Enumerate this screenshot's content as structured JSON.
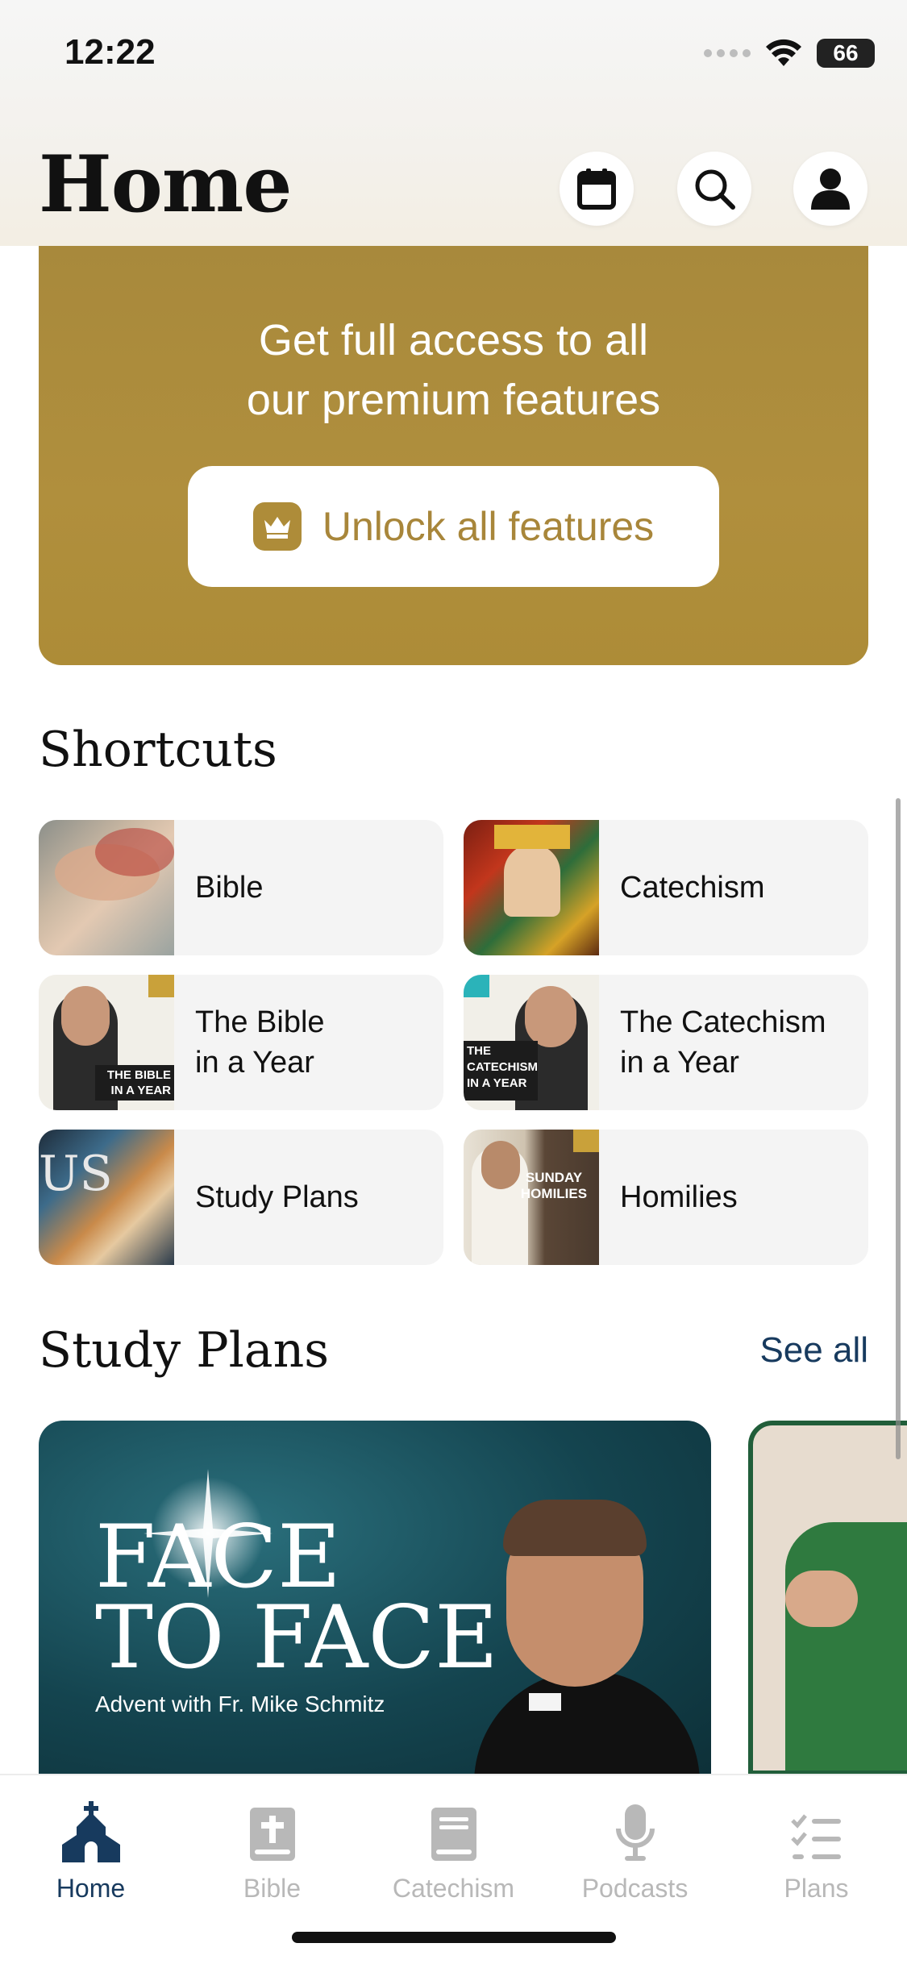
{
  "status_bar": {
    "time": "12:22",
    "battery": "66"
  },
  "header": {
    "title": "Home"
  },
  "promo": {
    "line1": "Get full access to all",
    "line2": "our premium features",
    "button_label": "Unlock all features"
  },
  "shortcuts": {
    "title": "Shortcuts",
    "items": [
      {
        "label": "Bible"
      },
      {
        "label": "Catechism"
      },
      {
        "label": "The Bible\nin a Year",
        "thumb_text": "THE BIBLE IN A YEAR"
      },
      {
        "label": "The Catechism\nin a Year",
        "thumb_text": "THE CATECHISM IN A YEAR"
      },
      {
        "label": "Study Plans"
      },
      {
        "label": "Homilies",
        "thumb_text": "SUNDAY HOMILIES"
      }
    ]
  },
  "study_plans": {
    "title": "Study Plans",
    "see_all": "See all",
    "featured": {
      "title_line1": "FACE",
      "title_line2": "TO FACE",
      "subtitle": "Advent with Fr. Mike Schmitz"
    }
  },
  "tabbar": {
    "items": [
      {
        "label": "Home",
        "icon": "church-icon",
        "active": true
      },
      {
        "label": "Bible",
        "icon": "bible-icon"
      },
      {
        "label": "Catechism",
        "icon": "book-icon"
      },
      {
        "label": "Podcasts",
        "icon": "microphone-icon"
      },
      {
        "label": "Plans",
        "icon": "checklist-icon"
      }
    ]
  },
  "colors": {
    "gold": "#ad8c37",
    "navy": "#173a5e",
    "tab_inactive": "#b8b8b8"
  }
}
